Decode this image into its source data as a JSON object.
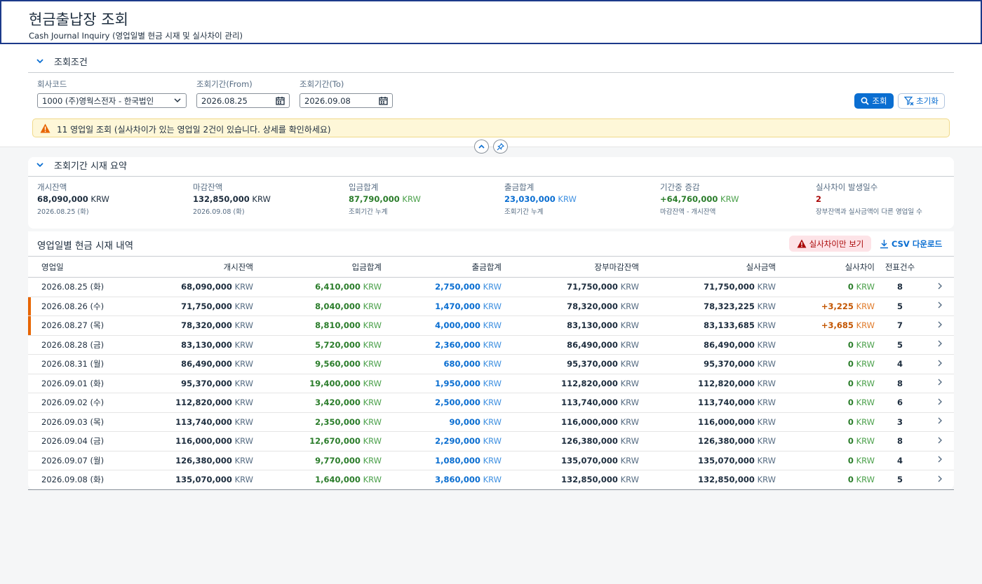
{
  "header": {
    "title": "현금출납장 조회",
    "subtitle": "Cash Journal Inquiry (영업일별 현금 시재 및 실사차이 관리)"
  },
  "filter": {
    "section_title": "조회조건",
    "company_label": "회사코드",
    "company_value": "1000 (주)영웍스전자 - 한국법인",
    "from_label": "조회기간(From)",
    "from_value": "2026.08.25",
    "to_label": "조회기간(To)",
    "to_value": "2026.09.08",
    "search_label": "조회",
    "reset_label": "초기화"
  },
  "message": {
    "text": "11 영업일 조회 (실사차이가 있는 영업일 2건이 있습니다. 상세를 확인하세요)"
  },
  "summary": {
    "section_title": "조회기간 시재 요약",
    "kpis": [
      {
        "label": "개시잔액",
        "value": "68,090,000",
        "unit": "KRW",
        "sub": "2026.08.25 (화)"
      },
      {
        "label": "마감잔액",
        "value": "132,850,000",
        "unit": "KRW",
        "sub": "2026.09.08 (화)"
      },
      {
        "label": "입금합계",
        "value": "87,790,000",
        "unit": "KRW",
        "sub": "조회기간 누계"
      },
      {
        "label": "출금합계",
        "value": "23,030,000",
        "unit": "KRW",
        "sub": "조회기간 누계"
      },
      {
        "label": "기간중 증감",
        "value": "+64,760,000",
        "unit": "KRW",
        "sub": "마감잔액 - 개시잔액"
      },
      {
        "label": "실사차이 발생일수",
        "value": "2",
        "unit": "",
        "sub": "장부잔액과 실사금액이 다른 영업일 수"
      }
    ]
  },
  "table": {
    "title": "영업일별 현금 시재 내역",
    "diff_only_label": "실사차이만 보기",
    "csv_label": "CSV 다운로드",
    "columns": [
      "영업일",
      "개시잔액",
      "입금합계",
      "출금합계",
      "장부마감잔액",
      "실사금액",
      "실사차이",
      "전표건수"
    ],
    "currency": "KRW",
    "rows": [
      {
        "date": "2026.08.25 (화)",
        "open": "68,090,000",
        "in": "6,410,000",
        "out": "2,750,000",
        "book": "71,750,000",
        "actual": "71,750,000",
        "diff": "0",
        "count": "8",
        "flag": false
      },
      {
        "date": "2026.08.26 (수)",
        "open": "71,750,000",
        "in": "8,040,000",
        "out": "1,470,000",
        "book": "78,320,000",
        "actual": "78,323,225",
        "diff": "+3,225",
        "count": "5",
        "flag": true
      },
      {
        "date": "2026.08.27 (목)",
        "open": "78,320,000",
        "in": "8,810,000",
        "out": "4,000,000",
        "book": "83,130,000",
        "actual": "83,133,685",
        "diff": "+3,685",
        "count": "7",
        "flag": true
      },
      {
        "date": "2026.08.28 (금)",
        "open": "83,130,000",
        "in": "5,720,000",
        "out": "2,360,000",
        "book": "86,490,000",
        "actual": "86,490,000",
        "diff": "0",
        "count": "5",
        "flag": false
      },
      {
        "date": "2026.08.31 (월)",
        "open": "86,490,000",
        "in": "9,560,000",
        "out": "680,000",
        "book": "95,370,000",
        "actual": "95,370,000",
        "diff": "0",
        "count": "4",
        "flag": false
      },
      {
        "date": "2026.09.01 (화)",
        "open": "95,370,000",
        "in": "19,400,000",
        "out": "1,950,000",
        "book": "112,820,000",
        "actual": "112,820,000",
        "diff": "0",
        "count": "8",
        "flag": false
      },
      {
        "date": "2026.09.02 (수)",
        "open": "112,820,000",
        "in": "3,420,000",
        "out": "2,500,000",
        "book": "113,740,000",
        "actual": "113,740,000",
        "diff": "0",
        "count": "6",
        "flag": false
      },
      {
        "date": "2026.09.03 (목)",
        "open": "113,740,000",
        "in": "2,350,000",
        "out": "90,000",
        "book": "116,000,000",
        "actual": "116,000,000",
        "diff": "0",
        "count": "3",
        "flag": false
      },
      {
        "date": "2026.09.04 (금)",
        "open": "116,000,000",
        "in": "12,670,000",
        "out": "2,290,000",
        "book": "126,380,000",
        "actual": "126,380,000",
        "diff": "0",
        "count": "8",
        "flag": false
      },
      {
        "date": "2026.09.07 (월)",
        "open": "126,380,000",
        "in": "9,770,000",
        "out": "1,080,000",
        "book": "135,070,000",
        "actual": "135,070,000",
        "diff": "0",
        "count": "4",
        "flag": false
      },
      {
        "date": "2026.09.08 (화)",
        "open": "135,070,000",
        "in": "1,640,000",
        "out": "3,860,000",
        "book": "132,850,000",
        "actual": "132,850,000",
        "diff": "0",
        "count": "5",
        "flag": false
      }
    ]
  },
  "colors": {
    "accent": "#0a6ed1",
    "positive": "#2b7d2b",
    "warning": "#e76500",
    "negative": "#aa0808",
    "header_border": "#1c3a8a"
  }
}
